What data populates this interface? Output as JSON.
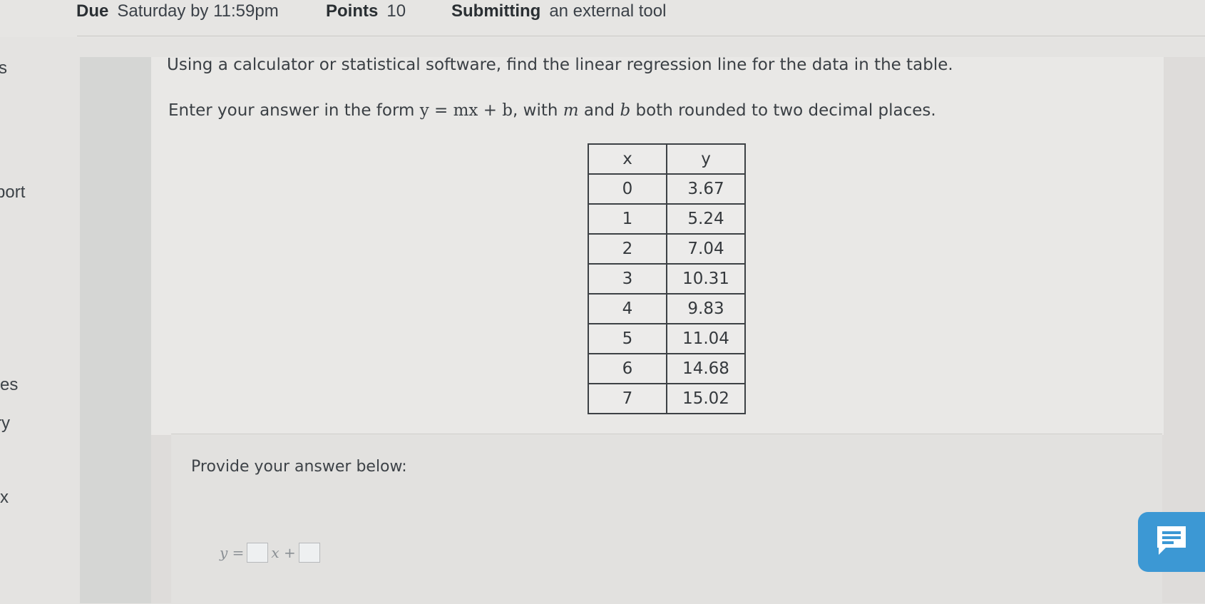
{
  "meta": {
    "due_label": "Due",
    "due_value": "Saturday by 11:59pm",
    "points_label": "Points",
    "points_value": "10",
    "submitting_label": "Submitting",
    "submitting_value": "an external tool"
  },
  "left_nav_fragments": [
    "s",
    "port",
    "es",
    "ry",
    "x"
  ],
  "question": {
    "instruction": "Using a calculator or statistical software, find the linear regression line for the data in the table.",
    "format_prefix": "Enter your answer in the form ",
    "format_math": "y = mx + b",
    "format_mid1": ", with ",
    "m_symbol": "m",
    "format_mid2": " and ",
    "b_symbol": "b",
    "format_suffix": " both rounded to two decimal places."
  },
  "table": {
    "headers": [
      "x",
      "y"
    ],
    "rows": [
      [
        "0",
        "3.67"
      ],
      [
        "1",
        "5.24"
      ],
      [
        "2",
        "7.04"
      ],
      [
        "3",
        "10.31"
      ],
      [
        "4",
        "9.83"
      ],
      [
        "5",
        "11.04"
      ],
      [
        "6",
        "14.68"
      ],
      [
        "7",
        "15.02"
      ]
    ]
  },
  "answer": {
    "prompt": "Provide your answer below:",
    "lhs": "y =",
    "x_var": "x +",
    "m_value": "",
    "b_value": ""
  },
  "icons": {
    "feedback": "chat-feedback-icon"
  },
  "colors": {
    "feedback_button": "#3c98d4"
  }
}
